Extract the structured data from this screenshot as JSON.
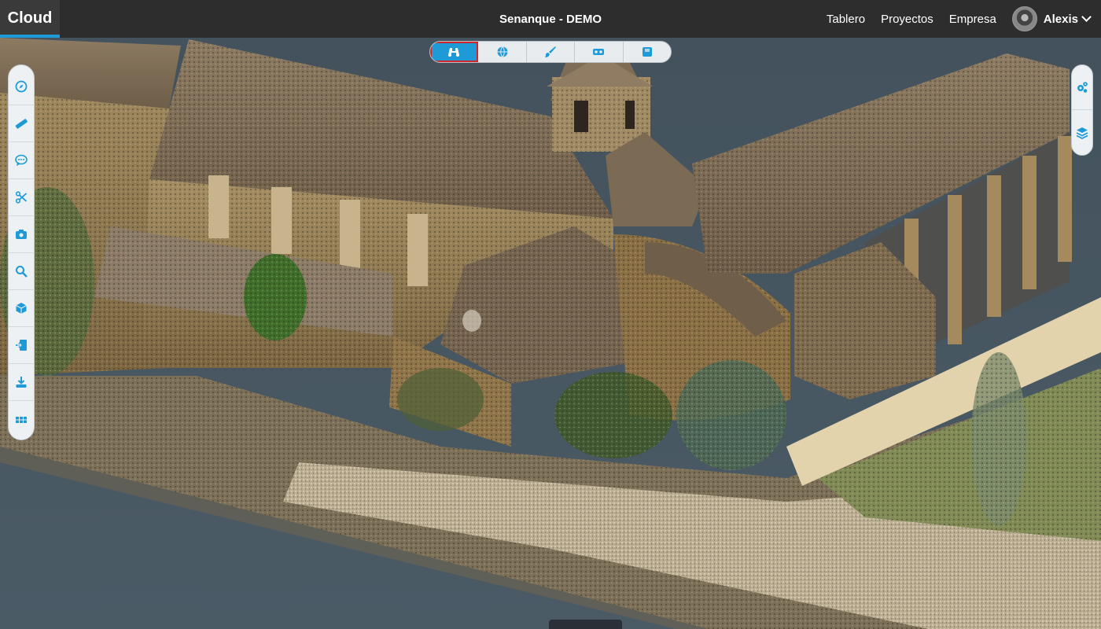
{
  "header": {
    "brand": "Cloud",
    "project_title": "Senanque - DEMO",
    "nav": [
      "Tablero",
      "Proyectos",
      "Empresa"
    ],
    "user": {
      "name": "Alexis"
    }
  },
  "view_toolbar": {
    "active_index": 0,
    "buttons": [
      "binoculars-icon",
      "globe-icon",
      "brush-icon",
      "vr-headset-icon",
      "square-view-icon"
    ]
  },
  "left_toolbar": {
    "tools": [
      "compass-icon",
      "ruler-icon",
      "comment-icon",
      "scissors-icon",
      "camera-icon",
      "search-icon",
      "cube-icon",
      "import-icon",
      "download-icon",
      "apps-grid-icon"
    ]
  },
  "right_toolbar": {
    "tools": [
      "settings-cogs-icon",
      "layers-icon"
    ]
  },
  "colors": {
    "accent": "#1e9bd7",
    "header_bg": "#2d2d2d",
    "highlight_border": "#d0262c",
    "viewer_bg": "#4a5a64"
  }
}
